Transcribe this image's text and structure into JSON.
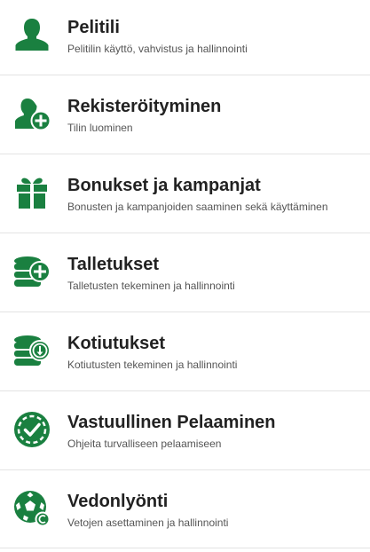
{
  "theme": {
    "accent": "#1a8040",
    "title_color": "#222222",
    "subtitle_color": "#555555",
    "divider_color": "#e3e3e3"
  },
  "menu": {
    "items": [
      {
        "icon": "user-icon",
        "title": "Pelitili",
        "subtitle": "Pelitilin käyttö, vahvistus ja hallinnointi"
      },
      {
        "icon": "user-plus-icon",
        "title": "Rekisteröityminen",
        "subtitle": "Tilin luominen"
      },
      {
        "icon": "gift-icon",
        "title": "Bonukset ja kampanjat",
        "subtitle": "Bonusten ja kampanjoiden saaminen sekä käyttäminen"
      },
      {
        "icon": "coins-plus-icon",
        "title": "Talletukset",
        "subtitle": "Talletusten tekeminen ja hallinnointi"
      },
      {
        "icon": "coins-download-icon",
        "title": "Kotiutukset",
        "subtitle": "Kotiutusten tekeminen ja hallinnointi"
      },
      {
        "icon": "chip-check-icon",
        "title": "Vastuullinen Pelaaminen",
        "subtitle": "Ohjeita turvalliseen pelaamiseen"
      },
      {
        "icon": "soccer-ball-icon",
        "title": "Vedonlyönti",
        "subtitle": "Vetojen asettaminen ja hallinnointi"
      }
    ]
  }
}
